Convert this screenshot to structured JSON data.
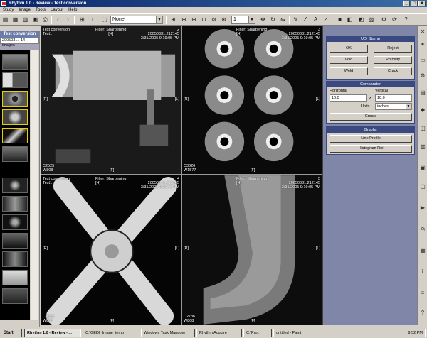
{
  "window": {
    "title": "Rhythm 1.0 - Review - Test conversion",
    "controls": [
      "_",
      "□",
      "✕"
    ]
  },
  "menu": [
    "Study",
    "Image",
    "Tools",
    "Layout",
    "Help"
  ],
  "toolbar": {
    "filter_value": "None",
    "frame_value": "1"
  },
  "thumbnails": {
    "header": "Test conversion",
    "subtitle": "200503.... 14 images"
  },
  "panes": [
    {
      "tl": "Test conversion\nTest1",
      "tc": "Filter: Sharpening\n[H]",
      "tr": "2\n20050331.212145\n3/31/2005 9:19:05 PM",
      "left": "[R]",
      "right": "[L]",
      "bl": "C2525\nW808",
      "bottom": "[F]"
    },
    {
      "tl": "",
      "tc": "Filter: Sharpening\n[H]",
      "tr": "3\n20050331.212145\n3/31/2005 9:19:05 PM",
      "left": "[R]",
      "right": "[L]",
      "bl": "C3026\nW1577",
      "bottom": "[F]"
    },
    {
      "tl": "Test conversion\nTest1",
      "tc": "Filter: Sharpening\n[H]",
      "tr": "4\n20050331.212145\n3/31/2005 9:19:05 PM",
      "left": "[R]",
      "right": "[L]",
      "bl": "C2525\nW808",
      "bottom": "[F]"
    },
    {
      "tl": "",
      "tc": "Filter: Sharpening\n[H]",
      "tr": "5\n20050331.212145\n3/31/2005 9:19:05 PM",
      "left": "[R]",
      "right": "[L]",
      "bl": "C2736\nW808",
      "bottom": "[F]"
    }
  ],
  "udi_stamp": {
    "title": "UDI Stamp",
    "buttons": [
      "OK",
      "Reject",
      "Void",
      "Porosity",
      "Weld",
      "Crack"
    ]
  },
  "comparator": {
    "title": "Comparator",
    "horizontal_label": "Horizontal",
    "vertical_label": "Vertical",
    "horizontal_value": "10.0",
    "vertical_value": "10.0",
    "x": "x",
    "units_label": "Units",
    "units_value": "inches",
    "create_label": "Create"
  },
  "graphs": {
    "title": "Graphs",
    "line_profile": "Line Profile",
    "histogram": "Histogram Roi"
  },
  "taskbar": {
    "start": "Start",
    "tasks": [
      "Rhythm 1.0 - Review - ...",
      "C:\\GEDI_Image_temp",
      "Windows Task Manager",
      "Rhythm Acquire",
      "C:\\Pro...",
      "untitled - Paint"
    ],
    "clock": "9:52 PM"
  }
}
